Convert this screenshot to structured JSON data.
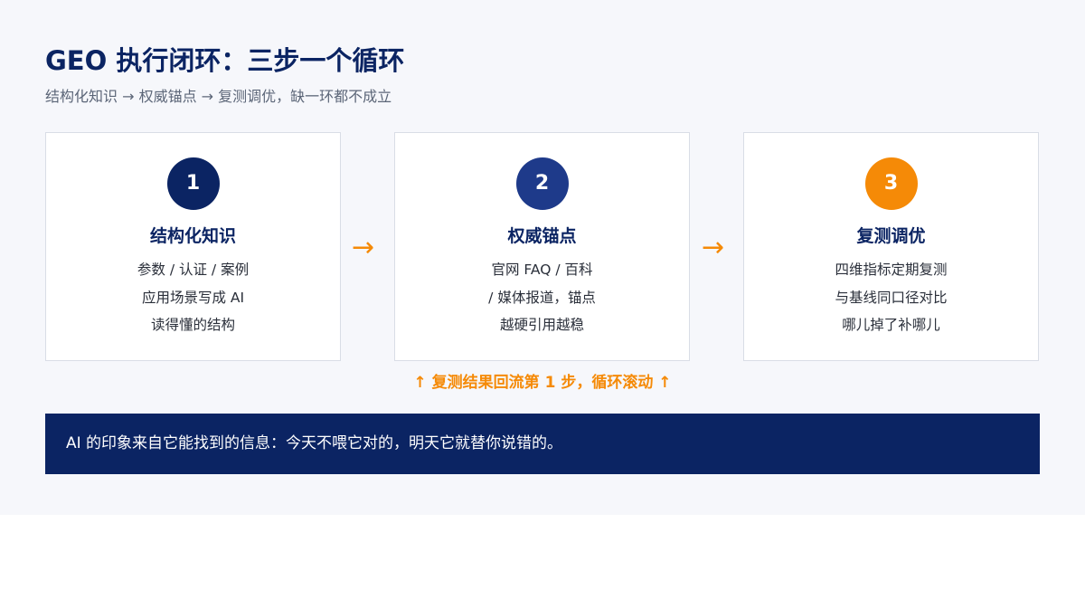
{
  "header": {
    "title": "GEO 执行闭环：三步一个循环",
    "subtitle": "结构化知识 → 权威锚点 → 复测调优，缺一环都不成立"
  },
  "steps": [
    {
      "number": "1",
      "title": "结构化知识",
      "lines": [
        "参数 / 认证 / 案例",
        "应用场景写成 AI",
        "读得懂的结构"
      ],
      "color": "#0b2463"
    },
    {
      "number": "2",
      "title": "权威锚点",
      "lines": [
        "官网 FAQ / 百科",
        "/ 媒体报道，锚点",
        "越硬引用越稳"
      ],
      "color": "#1e3a8a"
    },
    {
      "number": "3",
      "title": "复测调优",
      "lines": [
        "四维指标定期复测",
        "与基线同口径对比",
        "哪儿掉了补哪儿"
      ],
      "color": "#f58a07"
    }
  ],
  "connectors": {
    "arrow": "→"
  },
  "loop_note": "↑ 复测结果回流第 1 步，循环滚动 ↑",
  "banner": {
    "text": "AI 的印象来自它能找到的信息：今天不喂它对的，明天它就替你说错的。"
  },
  "colors": {
    "navy": "#0b2463",
    "orange": "#f58a07",
    "background": "#f6f7fb"
  }
}
